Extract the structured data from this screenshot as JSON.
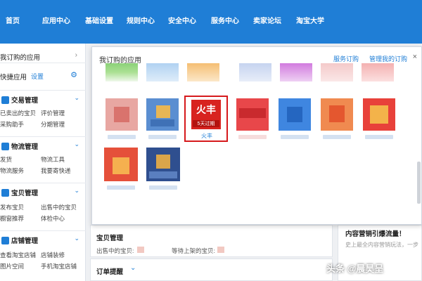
{
  "topnav": {
    "items": [
      "首页",
      "应用中心",
      "基础设置",
      "规则中心",
      "安全中心",
      "服务中心",
      "卖家论坛",
      "淘宝大学"
    ]
  },
  "sidebar": {
    "my_apps": "我订购的应用",
    "quick_apps": "快捷应用",
    "settings": "设置",
    "sections": [
      {
        "title": "交易管理",
        "links": [
          "已卖出的宝贝",
          "评价管理",
          "采购助手",
          "分期管理"
        ]
      },
      {
        "title": "物流管理",
        "links": [
          "发货",
          "物流工具",
          "物流服务",
          "我要寄快递"
        ]
      },
      {
        "title": "宝贝管理",
        "links": [
          "发布宝贝",
          "出售中的宝贝",
          "橱窗推荐",
          "体检中心"
        ]
      },
      {
        "title": "店铺管理",
        "links": [
          "查看淘宝店铺",
          "店铺装修",
          "图片空间",
          "手机淘宝店铺"
        ]
      }
    ]
  },
  "popup": {
    "title": "我订购的应用",
    "service_link": "服务订购",
    "manage_link": "管理我的订购",
    "close": "×",
    "featured": {
      "icon_text": "火丰",
      "badge": "5天过期",
      "label": "火丰"
    }
  },
  "main": {
    "baby_mgmt": "宝贝管理",
    "on_sale": "出售中的宝贝:",
    "pending": "等待上架的宝贝:",
    "order_remind": "订单提醒",
    "promo_title": "内容营销引爆流量！",
    "promo_text": "史上最全内容营销玩法，一步"
  },
  "watermark": "头条 @晨昊呈",
  "colors": {
    "brand_blue": "#1f7ed6",
    "alert_red": "#d6191c"
  }
}
